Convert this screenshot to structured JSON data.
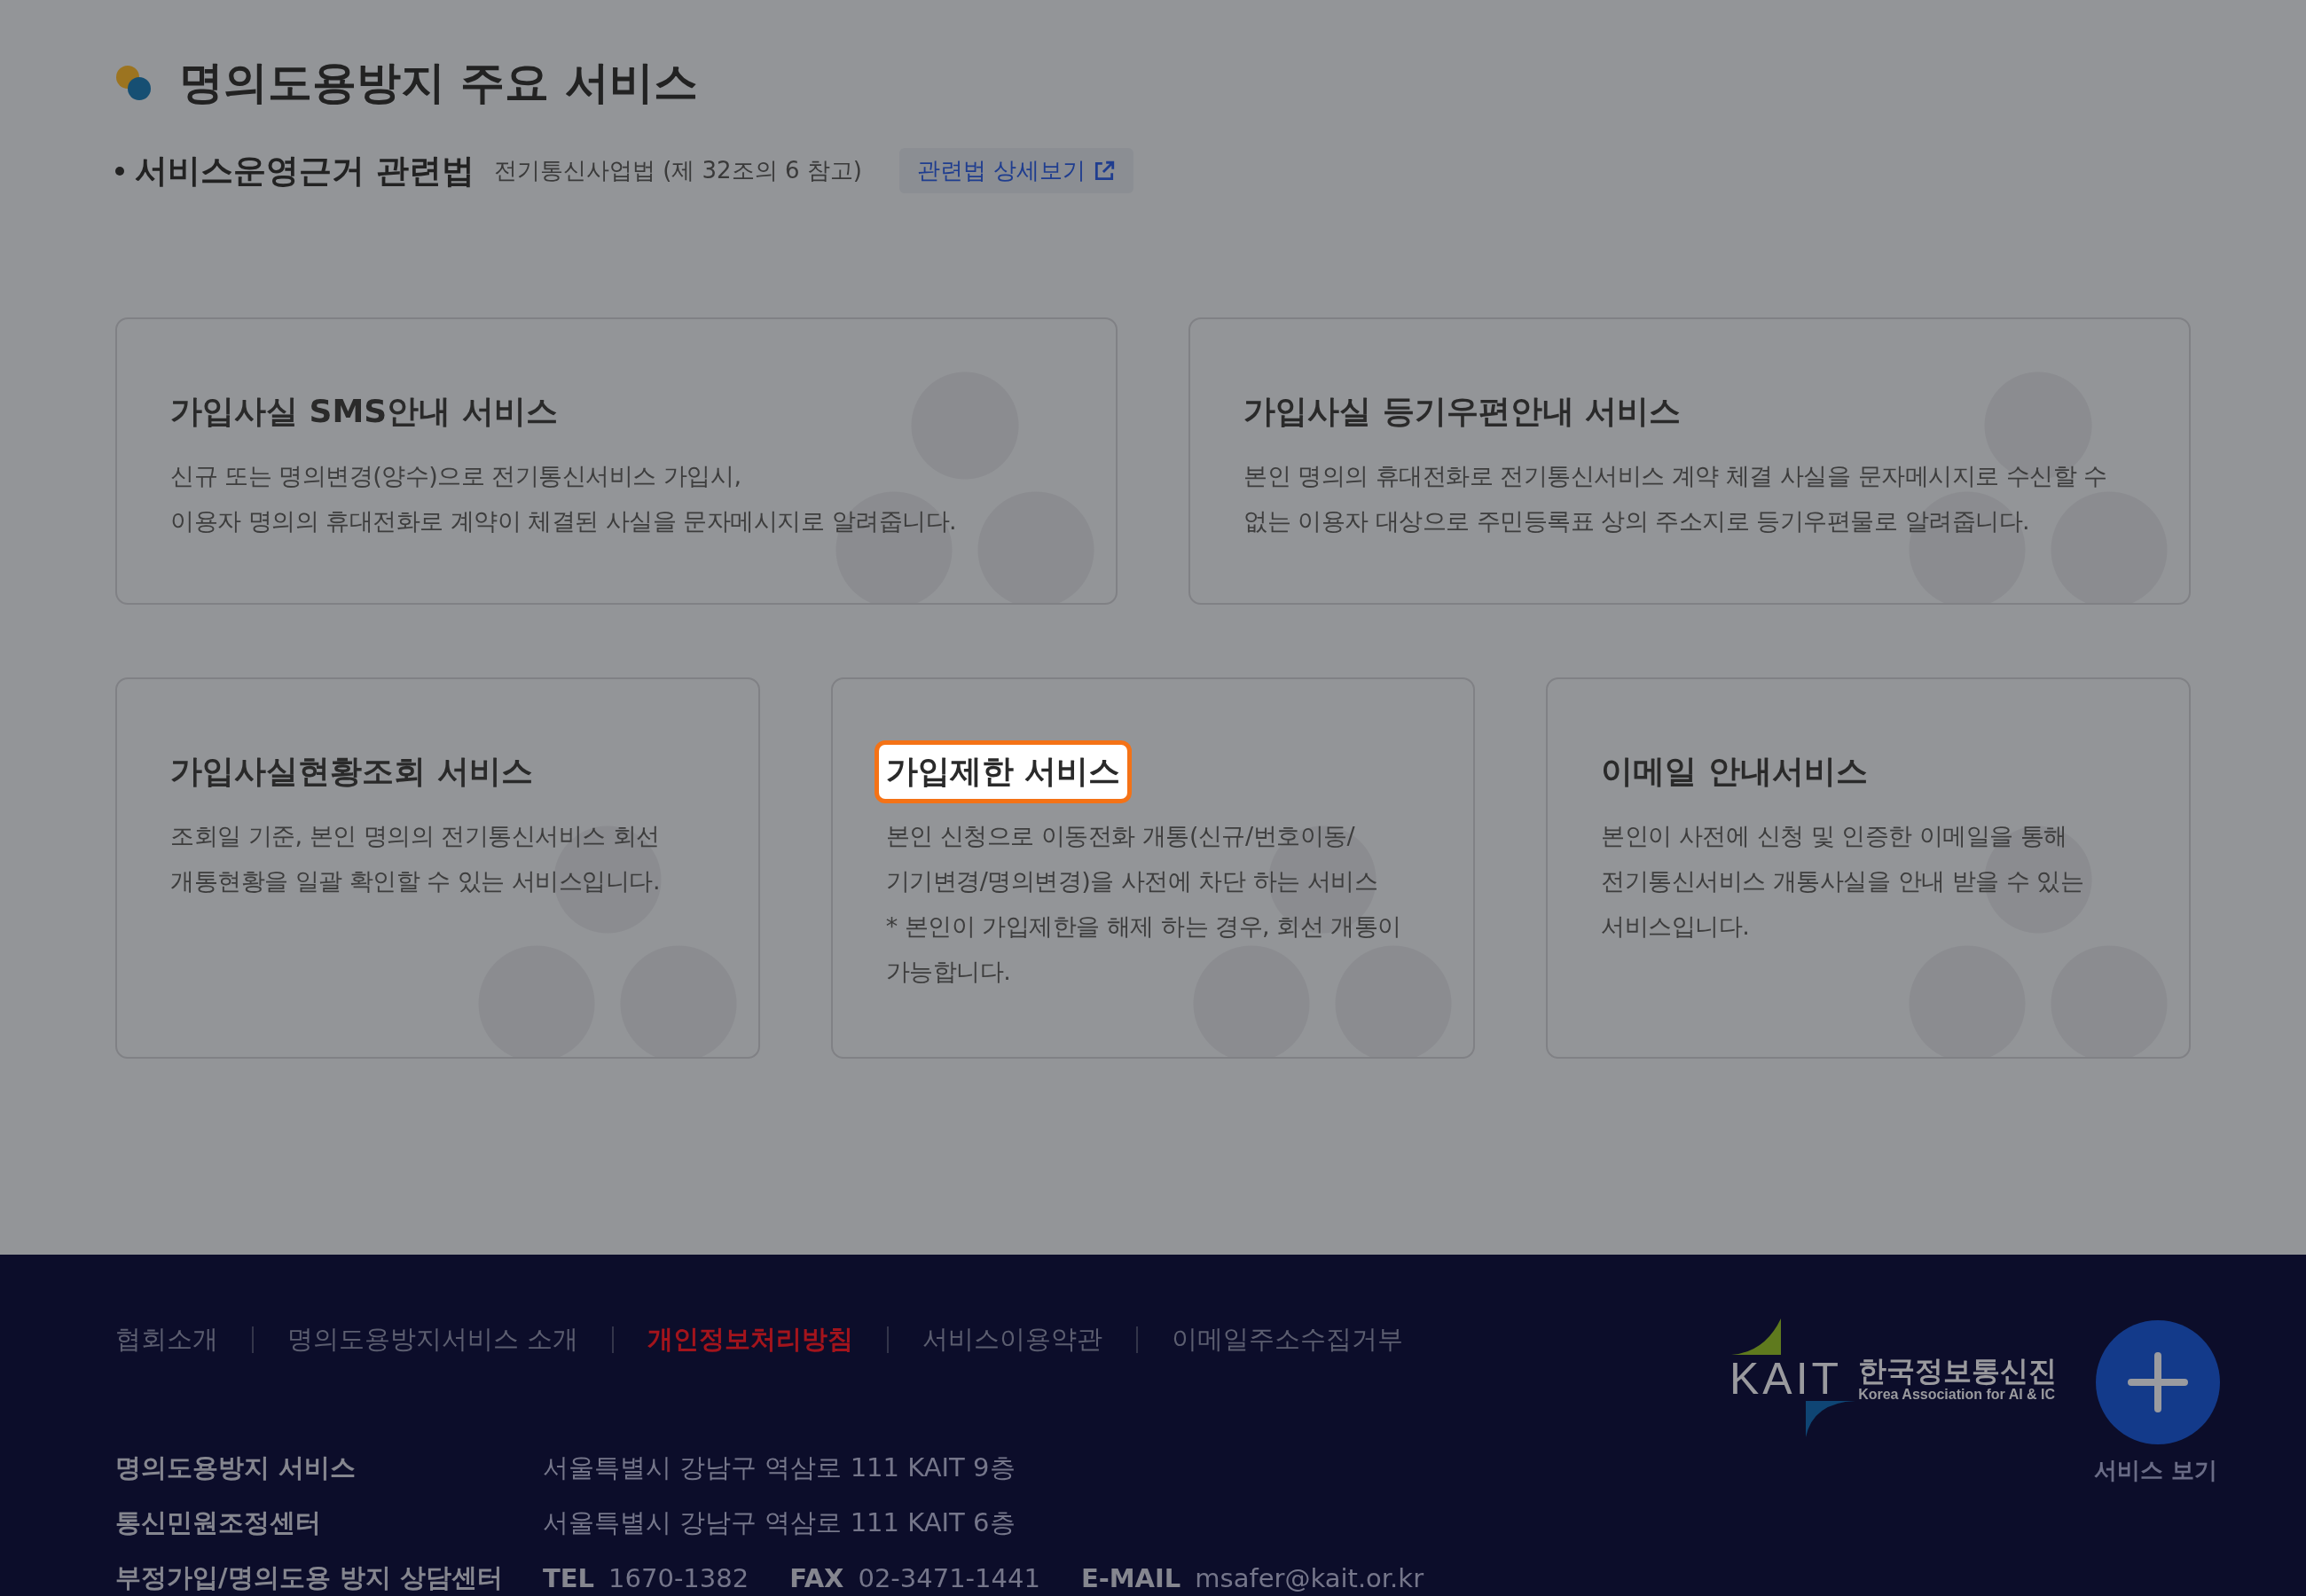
{
  "page_title": "명의도용방지 주요 서비스",
  "law": {
    "label": "서비스운영근거 관련법",
    "reference": "전기통신사업법 (제 32조의 6 참고)",
    "link": "관련법 상세보기"
  },
  "service_rows": [
    {
      "cards": [
        {
          "title": "가입사실 SMS안내 서비스",
          "description": [
            "신규 또는 명의변경(양수)으로 전기통신서비스 가입시,",
            "이용자 명의의 휴대전화로 계약이 체결된 사실을 문자메시지로 알려줍니다."
          ],
          "highlighted": false
        },
        {
          "title": "가입사실 등기우편안내 서비스",
          "description": [
            "본인 명의의 휴대전화로 전기통신서비스 계약 체결 사실을 문자메시지로 수신할 수",
            "없는 이용자 대상으로 주민등록표 상의 주소지로 등기우편물로 알려줍니다."
          ],
          "highlighted": false
        }
      ]
    },
    {
      "cards": [
        {
          "title": "가입사실현황조회 서비스",
          "description": [
            "조회일 기준, 본인 명의의 전기통신서비스 회선",
            "개통현황을 일괄 확인할 수 있는 서비스입니다."
          ],
          "highlighted": false
        },
        {
          "title": "가입제한 서비스",
          "description": [
            "본인 신청으로 이동전화 개통(신규/번호이동/",
            "기기변경/명의변경)을 사전에 차단 하는 서비스",
            "* 본인이 가입제한을 해제 하는 경우, 회선 개통이",
            "가능합니다."
          ],
          "highlighted": true
        },
        {
          "title": "이메일 안내서비스",
          "description": [
            "본인이 사전에 신청 및 인증한 이메일을 통해",
            "전기통신서비스 개통사실을 안내 받을 수 있는",
            "서비스입니다."
          ],
          "highlighted": false
        }
      ]
    }
  ],
  "footer": {
    "links": [
      {
        "label": "협회소개",
        "emphasized": false
      },
      {
        "label": "명의도용방지서비스 소개",
        "emphasized": false
      },
      {
        "label": "개인정보처리방침",
        "emphasized": true
      },
      {
        "label": "서비스이용약관",
        "emphasized": false
      },
      {
        "label": "이메일주소수집거부",
        "emphasized": false
      }
    ],
    "logo": {
      "wordmark": "KAIT",
      "name": "한국정보통신진",
      "subtitle": "Korea Association for AI & IC"
    },
    "info": [
      {
        "kind": "address",
        "label": "명의도용방지 서비스",
        "value": "서울특별시 강남구 역삼로 111 KAIT 9층"
      },
      {
        "kind": "address",
        "label": "통신민원조정센터",
        "value": "서울특별시 강남구 역삼로 111 KAIT 6층"
      },
      {
        "kind": "contacts",
        "label": "부정가입/명의도용 방지 상담센터",
        "contacts": [
          {
            "label": "TEL",
            "value": "1670-1382"
          },
          {
            "label": "FAX",
            "value": "02-3471-1441"
          },
          {
            "label": "E-MAIL",
            "value": "msafer@kait.or.kr"
          }
        ]
      }
    ]
  },
  "fab": {
    "label": "서비스 보기"
  }
}
